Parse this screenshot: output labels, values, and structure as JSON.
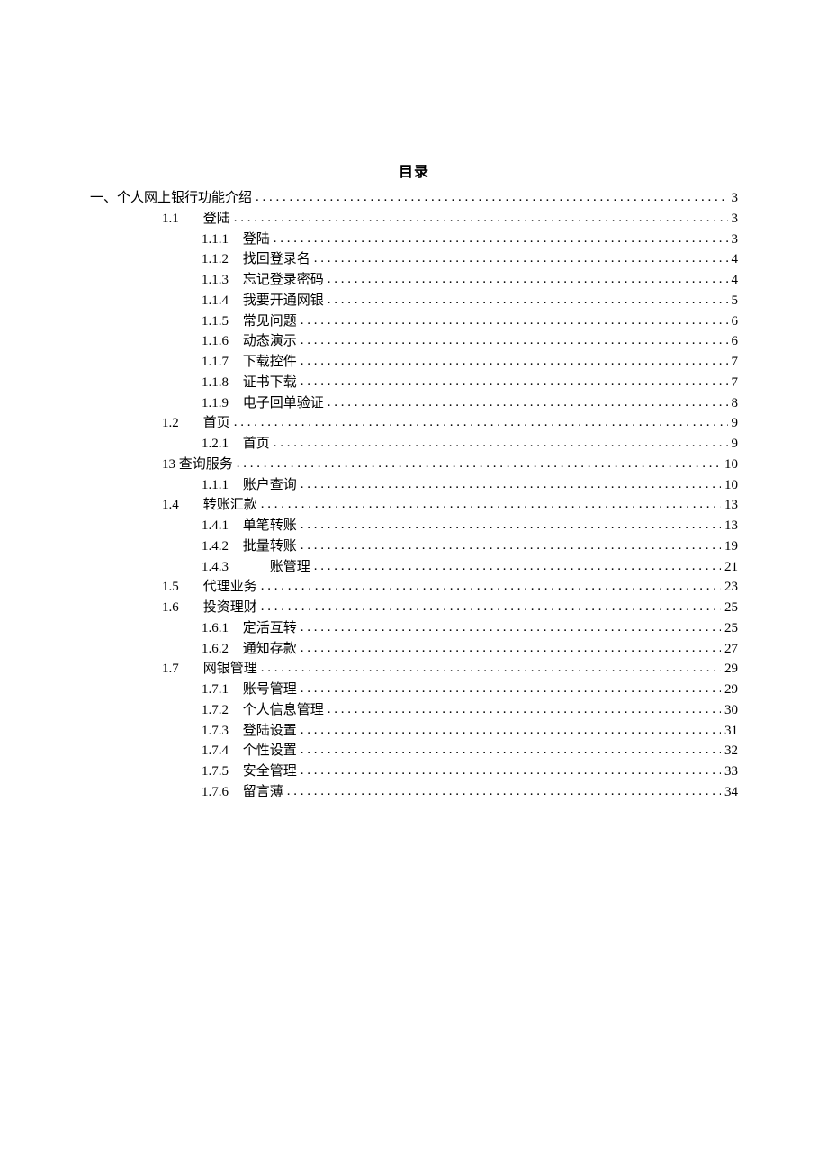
{
  "title": "目录",
  "toc": [
    {
      "level": 1,
      "label": "一、个人网上银行功能介绍",
      "page": "3"
    },
    {
      "level": 2,
      "number": "1.1",
      "text": "登陆",
      "page": "3"
    },
    {
      "level": 3,
      "number": "1.1.1",
      "text": "登陆",
      "page": "3"
    },
    {
      "level": 3,
      "number": "1.1.2",
      "text": "找回登录名",
      "page": "4"
    },
    {
      "level": 3,
      "number": "1.1.3",
      "text": "忘记登录密码",
      "page": "4"
    },
    {
      "level": 3,
      "number": "1.1.4",
      "text": "我要开通网银",
      "page": "5"
    },
    {
      "level": 3,
      "number": "1.1.5",
      "text": "常见问题",
      "page": "6"
    },
    {
      "level": 3,
      "number": "1.1.6",
      "text": "动态演示",
      "page": "6"
    },
    {
      "level": 3,
      "number": "1.1.7",
      "text": "下载控件",
      "page": "7"
    },
    {
      "level": 3,
      "number": "1.1.8",
      "text": "证书下载",
      "page": "7"
    },
    {
      "level": 3,
      "number": "1.1.9",
      "text": "电子回单验证",
      "page": "8"
    },
    {
      "level": 2,
      "number": "1.2",
      "text": "首页",
      "page": "9"
    },
    {
      "level": 3,
      "number": "1.2.1",
      "text": "首页",
      "page": "9"
    },
    {
      "level": 2,
      "label": "13 查询服务",
      "page": "10"
    },
    {
      "level": 3,
      "number": "1.1.1",
      "text": "账户查询",
      "page": "10"
    },
    {
      "level": 2,
      "number": "1.4",
      "text": "转账汇款",
      "page": "13"
    },
    {
      "level": 3,
      "number": "1.4.1",
      "text": "单笔转账",
      "page": "13"
    },
    {
      "level": 3,
      "number": "1.4.2",
      "text": "批量转账",
      "page": "19"
    },
    {
      "level": 3,
      "number": "1.4.3",
      "text": "　　账管理",
      "page": "21"
    },
    {
      "level": 2,
      "number": "1.5",
      "text": "代理业务",
      "page": "23"
    },
    {
      "level": 2,
      "number": "1.6",
      "text": "投资理财",
      "page": "25"
    },
    {
      "level": 3,
      "number": "1.6.1",
      "text": "定活互转",
      "page": "25"
    },
    {
      "level": 3,
      "number": "1.6.2",
      "text": "通知存款",
      "page": "27"
    },
    {
      "level": 2,
      "number": "1.7",
      "text": "网银管理",
      "page": "29"
    },
    {
      "level": 3,
      "number": "1.7.1",
      "text": "账号管理",
      "page": "29"
    },
    {
      "level": 3,
      "number": "1.7.2",
      "text": "个人信息管理",
      "page": "30"
    },
    {
      "level": 3,
      "number": "1.7.3",
      "text": "登陆设置",
      "page": "31"
    },
    {
      "level": 3,
      "number": "1.7.4",
      "text": "个性设置",
      "page": "32"
    },
    {
      "level": 3,
      "number": "1.7.5",
      "text": "安全管理",
      "page": "33"
    },
    {
      "level": 3,
      "number": "1.7.6",
      "text": "留言薄",
      "page": "34"
    }
  ]
}
